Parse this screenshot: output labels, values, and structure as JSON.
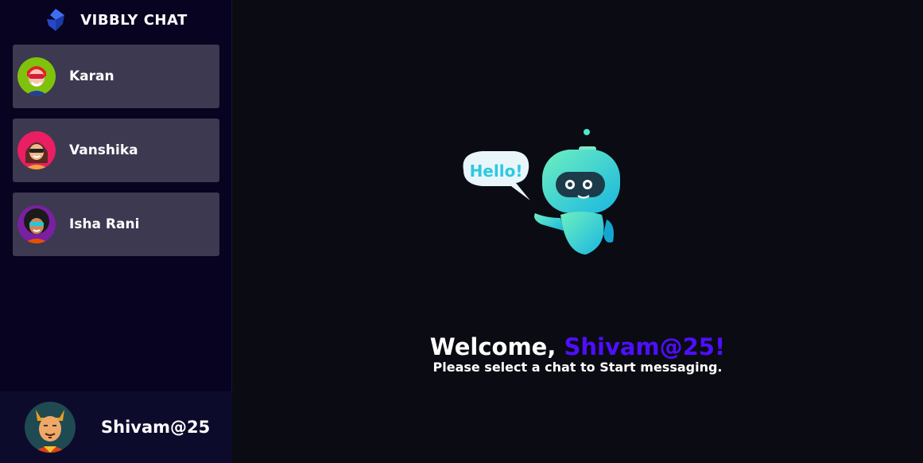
{
  "brand": {
    "name": "VIBBLY CHAT",
    "logo_icon": "brand-logo-icon"
  },
  "contacts": [
    {
      "name": "Karan",
      "avatar_icon": "avatar-karan-icon"
    },
    {
      "name": "Vanshika",
      "avatar_icon": "avatar-vanshika-icon"
    },
    {
      "name": "Isha Rani",
      "avatar_icon": "avatar-isha-icon"
    }
  ],
  "current_user": {
    "name": "Shivam@25",
    "avatar_icon": "avatar-user-icon"
  },
  "welcome": {
    "greeting": "Welcome,",
    "username": "Shivam@25!",
    "subtitle": "Please select a chat to Start messaging.",
    "illustration_text": "Hello!"
  },
  "colors": {
    "accent": "#4e0eff",
    "sidebar_bg": "#070320",
    "contact_bg": "#3d3950",
    "main_bg": "#0b0b13"
  }
}
